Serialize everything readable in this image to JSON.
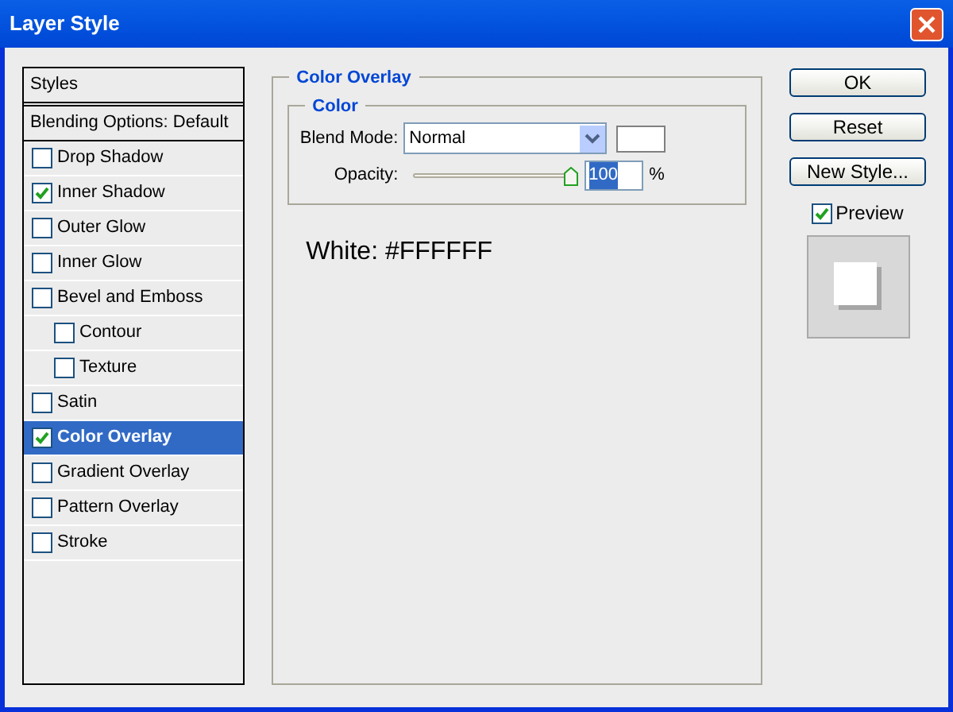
{
  "window": {
    "title": "Layer Style"
  },
  "sidebar": {
    "header": "Styles",
    "blending": "Blending Options: Default",
    "items": [
      {
        "label": "Drop Shadow",
        "checked": false,
        "selected": false
      },
      {
        "label": "Inner Shadow",
        "checked": true,
        "selected": false
      },
      {
        "label": "Outer Glow",
        "checked": false,
        "selected": false
      },
      {
        "label": "Inner Glow",
        "checked": false,
        "selected": false
      },
      {
        "label": "Bevel and Emboss",
        "checked": false,
        "selected": false,
        "children": [
          {
            "label": "Contour",
            "checked": false,
            "selected": false
          },
          {
            "label": "Texture",
            "checked": false,
            "selected": false
          }
        ]
      },
      {
        "label": "Satin",
        "checked": false,
        "selected": false
      },
      {
        "label": "Color Overlay",
        "checked": true,
        "selected": true
      },
      {
        "label": "Gradient Overlay",
        "checked": false,
        "selected": false
      },
      {
        "label": "Pattern Overlay",
        "checked": false,
        "selected": false
      },
      {
        "label": "Stroke",
        "checked": false,
        "selected": false
      }
    ]
  },
  "panel": {
    "title": "Color Overlay",
    "group": "Color",
    "blend_mode_label": "Blend Mode:",
    "blend_mode": "Normal",
    "opacity_label": "Opacity:",
    "opacity": {
      "level": 1
    },
    "opacity_value": "100",
    "opacity_unit": "%",
    "note": "White: #FFFFFF"
  },
  "buttons": [
    "OK",
    "Reset",
    "New Style..."
  ],
  "preview": {
    "label": "Preview",
    "checked": true
  }
}
